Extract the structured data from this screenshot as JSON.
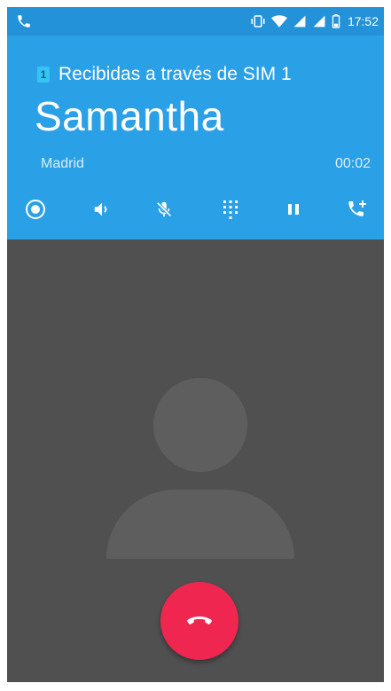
{
  "status_bar": {
    "time": "17:52",
    "icons": [
      "phone-call-icon",
      "vibrate-icon",
      "wifi-icon",
      "signal-icon",
      "signal-icon",
      "battery-icon"
    ]
  },
  "call": {
    "sim_badge": "1",
    "sim_label": "Recibidas a través de SIM 1",
    "caller_name": "Samantha",
    "location": "Madrid",
    "timer": "00:02"
  },
  "controls": [
    {
      "name": "record-icon"
    },
    {
      "name": "speaker-icon"
    },
    {
      "name": "mute-icon"
    },
    {
      "name": "dialpad-icon"
    },
    {
      "name": "pause-icon"
    },
    {
      "name": "add-call-icon"
    }
  ],
  "colors": {
    "header": "#2aa0e6",
    "status_bar": "#2492d8",
    "background": "#505050",
    "avatar": "#5e5e5e",
    "end_call": "#ef2650"
  }
}
